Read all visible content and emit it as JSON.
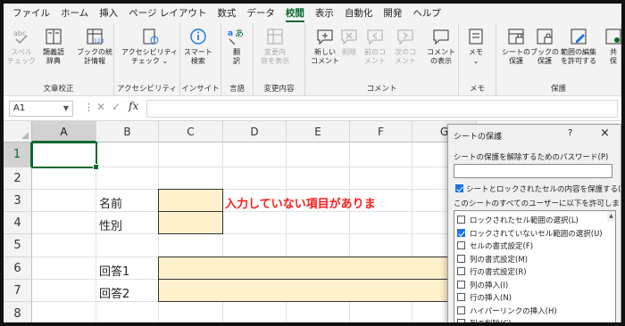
{
  "menu": {
    "items": [
      "ファイル",
      "ホーム",
      "挿入",
      "ページ レイアウト",
      "数式",
      "データ",
      "校閲",
      "表示",
      "自動化",
      "開発",
      "ヘルプ"
    ],
    "active_index": 6
  },
  "ribbon": {
    "groups": [
      {
        "label": "文章校正",
        "buttons": [
          {
            "l1": "スペル",
            "l2": "チェック",
            "icon": "spell-check-icon",
            "disabled": true
          },
          {
            "l1": "類義語",
            "l2": "辞典",
            "icon": "thesaurus-icon",
            "disabled": false
          },
          {
            "l1": "ブックの統",
            "l2": "計情報",
            "icon": "workbook-statistics-icon",
            "disabled": false
          }
        ]
      },
      {
        "label": "アクセシビリティ",
        "buttons": [
          {
            "l1": "アクセシビリティ",
            "l2": "チェック ⌄",
            "icon": "accessibility-icon",
            "disabled": false
          }
        ]
      },
      {
        "label": "インサイト",
        "buttons": [
          {
            "l1": "スマート",
            "l2": "検索",
            "icon": "smart-lookup-icon",
            "disabled": false
          }
        ]
      },
      {
        "label": "言語",
        "buttons": [
          {
            "l1": "翻",
            "l2": "訳",
            "icon": "translate-icon",
            "disabled": false
          }
        ]
      },
      {
        "label": "変更内容",
        "buttons": [
          {
            "l1": "変更内",
            "l2": "容を表示",
            "icon": "show-changes-icon",
            "disabled": true
          }
        ]
      },
      {
        "label": "コメント",
        "buttons": [
          {
            "l1": "新しい",
            "l2": "コメント",
            "icon": "new-comment-icon",
            "disabled": false
          },
          {
            "l1": "削除",
            "l2": "",
            "icon": "delete-comment-icon",
            "disabled": true
          },
          {
            "l1": "前のコ",
            "l2": "メント",
            "icon": "previous-comment-icon",
            "disabled": true
          },
          {
            "l1": "次のコ",
            "l2": "メント",
            "icon": "next-comment-icon",
            "disabled": true
          },
          {
            "l1": "コメント",
            "l2": "の表示",
            "icon": "show-comments-icon",
            "disabled": false
          }
        ]
      },
      {
        "label": "メモ",
        "buttons": [
          {
            "l1": "メモ",
            "l2": "⌄",
            "icon": "notes-icon",
            "disabled": false
          }
        ]
      },
      {
        "label": "保護",
        "buttons": [
          {
            "l1": "シートの",
            "l2": "保護",
            "icon": "protect-sheet-icon",
            "disabled": false
          },
          {
            "l1": "ブックの",
            "l2": "保護",
            "icon": "protect-workbook-icon",
            "disabled": false
          },
          {
            "l1": "範囲の編集",
            "l2": "を許可する",
            "icon": "allow-edit-ranges-icon",
            "disabled": false
          },
          {
            "l1": "共",
            "l2": "保",
            "icon": "share-workbook-icon",
            "disabled": false
          }
        ]
      }
    ]
  },
  "formula_bar": {
    "name_box": "A1",
    "fx": "fx",
    "value": ""
  },
  "grid": {
    "columns": [
      "A",
      "B",
      "C",
      "D",
      "E",
      "F",
      "G"
    ],
    "rows": [
      "1",
      "2",
      "3",
      "4",
      "5",
      "6",
      "7",
      "8"
    ],
    "cells": {
      "B3": "名前",
      "B4": "性別",
      "B6": "回答1",
      "B7": "回答2",
      "D3": "入力していない項目がありま"
    },
    "input_fill_color": "#fff1cc",
    "warning_color": "#ff1a1a",
    "accent_color": "#0b6a2f"
  },
  "dialog": {
    "title": "シートの保護",
    "help": "?",
    "close": "×",
    "password_label": "シートの保護を解除するためのパスワード(P)",
    "protect_checkbox_label": "シートとロックされたセルの内容を保護する(C)",
    "protect_checked": true,
    "allow_label": "このシートのすべてのユーザーに以下を許可します。",
    "options": [
      {
        "label": "ロックされたセル範囲の選択(L)",
        "checked": false
      },
      {
        "label": "ロックされていないセル範囲の選択(U)",
        "checked": true
      },
      {
        "label": "セルの書式設定(F)",
        "checked": false
      },
      {
        "label": "列の書式設定(M)",
        "checked": false
      },
      {
        "label": "行の書式設定(R)",
        "checked": false
      },
      {
        "label": "列の挿入(I)",
        "checked": false
      },
      {
        "label": "行の挿入(N)",
        "checked": false
      },
      {
        "label": "ハイパーリンクの挿入(H)",
        "checked": false
      },
      {
        "label": "列の削除(C)",
        "checked": false
      }
    ]
  }
}
